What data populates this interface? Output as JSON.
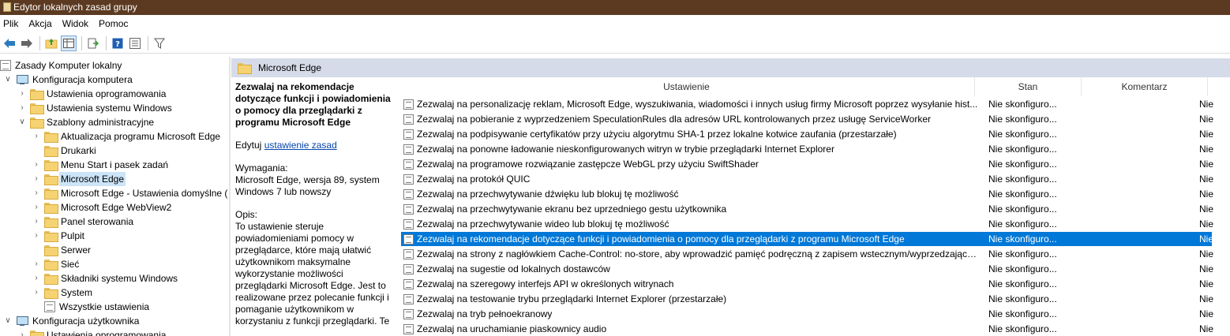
{
  "window": {
    "title": "Edytor lokalnych zasad grupy"
  },
  "menu": [
    "Plik",
    "Akcja",
    "Widok",
    "Pomoc"
  ],
  "toolbar_icons": [
    "back-arrow-icon",
    "forward-arrow-icon",
    "up-folder-icon",
    "show-hide-tree-icon",
    "export-list-icon",
    "help-icon",
    "properties-icon",
    "filter-icon"
  ],
  "tree": [
    {
      "label": "Zasady Komputer lokalny",
      "icon": "doc",
      "indent": 0,
      "expander": ""
    },
    {
      "label": "Konfiguracja komputera",
      "icon": "pc",
      "indent": 1,
      "expander": "expanded"
    },
    {
      "label": "Ustawienia oprogramowania",
      "icon": "folder",
      "indent": 2,
      "expander": "collapsed"
    },
    {
      "label": "Ustawienia systemu Windows",
      "icon": "folder",
      "indent": 2,
      "expander": "collapsed"
    },
    {
      "label": "Szablony administracyjne",
      "icon": "folder",
      "indent": 2,
      "expander": "expanded"
    },
    {
      "label": "Aktualizacja programu Microsoft Edge",
      "icon": "folder",
      "indent": 3,
      "expander": "collapsed"
    },
    {
      "label": "Drukarki",
      "icon": "folder",
      "indent": 3,
      "expander": ""
    },
    {
      "label": "Menu Start i pasek zadań",
      "icon": "folder",
      "indent": 3,
      "expander": "collapsed"
    },
    {
      "label": "Microsoft Edge",
      "icon": "folder",
      "indent": 3,
      "expander": "collapsed",
      "selected": true
    },
    {
      "label": "Microsoft Edge - Ustawienia domyślne (",
      "icon": "folder",
      "indent": 3,
      "expander": "collapsed"
    },
    {
      "label": "Microsoft Edge WebView2",
      "icon": "folder",
      "indent": 3,
      "expander": "collapsed"
    },
    {
      "label": "Panel sterowania",
      "icon": "folder",
      "indent": 3,
      "expander": "collapsed"
    },
    {
      "label": "Pulpit",
      "icon": "folder",
      "indent": 3,
      "expander": "collapsed"
    },
    {
      "label": "Serwer",
      "icon": "folder",
      "indent": 3,
      "expander": ""
    },
    {
      "label": "Sieć",
      "icon": "folder",
      "indent": 3,
      "expander": "collapsed"
    },
    {
      "label": "Składniki systemu Windows",
      "icon": "folder",
      "indent": 3,
      "expander": "collapsed"
    },
    {
      "label": "System",
      "icon": "folder",
      "indent": 3,
      "expander": "collapsed"
    },
    {
      "label": "Wszystkie ustawienia",
      "icon": "doc",
      "indent": 3,
      "expander": ""
    },
    {
      "label": "Konfiguracja użytkownika",
      "icon": "pc",
      "indent": 1,
      "expander": "expanded"
    },
    {
      "label": "Ustawienia oprogramowania",
      "icon": "folder",
      "indent": 2,
      "expander": "collapsed"
    }
  ],
  "right_header": "Microsoft Edge",
  "description": {
    "title": "Zezwalaj na rekomendacje dotyczące funkcji i powiadomienia o pomocy dla przeglądarki z programu Microsoft Edge",
    "edit_prefix": "Edytuj ",
    "edit_link": "ustawienie zasad",
    "requirements_label": "Wymagania:",
    "requirements": "Microsoft Edge, wersja 89, system Windows 7 lub nowszy",
    "opis_label": "Opis:",
    "opis": "To ustawienie steruje powiadomieniami pomocy w przeglądarce, które mają ułatwić użytkownikom maksymalne wykorzystanie możliwości przeglądarki Microsoft Edge. Jest to realizowane przez polecanie funkcji i pomaganie użytkownikom w korzystaniu z funkcji przeglądarki. Te"
  },
  "columns": {
    "setting": "Ustawienie",
    "state": "Stan",
    "comment": "Komentarz"
  },
  "rows": [
    {
      "setting": "Zezwalaj na personalizację reklam, Microsoft Edge, wyszukiwania, wiadomości i innych usług firmy Microsoft poprzez wysyłanie hist...",
      "state": "Nie skonfiguro...",
      "comment": "Nie"
    },
    {
      "setting": "Zezwalaj na pobieranie z wyprzedzeniem SpeculationRules dla adresów URL kontrolowanych przez usługę ServiceWorker",
      "state": "Nie skonfiguro...",
      "comment": "Nie"
    },
    {
      "setting": "Zezwalaj na podpisywanie certyfikatów przy użyciu algorytmu SHA-1 przez lokalne kotwice zaufania (przestarzałe)",
      "state": "Nie skonfiguro...",
      "comment": "Nie"
    },
    {
      "setting": "Zezwalaj na ponowne ładowanie nieskonfigurowanych witryn w trybie przeglądarki Internet Explorer",
      "state": "Nie skonfiguro...",
      "comment": "Nie"
    },
    {
      "setting": "Zezwalaj na programowe rozwiązanie zastępcze WebGL przy użyciu SwiftShader",
      "state": "Nie skonfiguro...",
      "comment": "Nie"
    },
    {
      "setting": "Zezwalaj na protokół QUIC",
      "state": "Nie skonfiguro...",
      "comment": "Nie"
    },
    {
      "setting": "Zezwalaj na przechwytywanie dźwięku lub blokuj tę możliwość",
      "state": "Nie skonfiguro...",
      "comment": "Nie"
    },
    {
      "setting": "Zezwalaj na przechwytywanie ekranu bez uprzedniego gestu użytkownika",
      "state": "Nie skonfiguro...",
      "comment": "Nie"
    },
    {
      "setting": "Zezwalaj na przechwytywanie wideo lub blokuj tę możliwość",
      "state": "Nie skonfiguro...",
      "comment": "Nie"
    },
    {
      "setting": "Zezwalaj na rekomendacje dotyczące funkcji i powiadomienia o pomocy dla przeglądarki z programu Microsoft Edge",
      "state": "Nie skonfiguro...",
      "comment": "Nie",
      "selected": true
    },
    {
      "setting": "Zezwalaj na strony z nagłówkiem Cache-Control: no-store, aby wprowadzić pamięć podręczną z zapisem wstecznym/wyprzedzającym",
      "state": "Nie skonfiguro...",
      "comment": "Nie"
    },
    {
      "setting": "Zezwalaj na sugestie od lokalnych dostawców",
      "state": "Nie skonfiguro...",
      "comment": "Nie"
    },
    {
      "setting": "Zezwalaj na szeregowy interfejs API w określonych witrynach",
      "state": "Nie skonfiguro...",
      "comment": "Nie"
    },
    {
      "setting": "Zezwalaj na testowanie trybu przeglądarki Internet Explorer (przestarzałe)",
      "state": "Nie skonfiguro...",
      "comment": "Nie"
    },
    {
      "setting": "Zezwalaj na tryb pełnoekranowy",
      "state": "Nie skonfiguro...",
      "comment": "Nie"
    },
    {
      "setting": "Zezwalaj na uruchamianie piaskownicy audio",
      "state": "Nie skonfiguro...",
      "comment": "Nie"
    }
  ],
  "colors": {
    "titlebar": "#5c3a21",
    "selection": "#0078d7",
    "header_band": "#d6dbe9"
  }
}
